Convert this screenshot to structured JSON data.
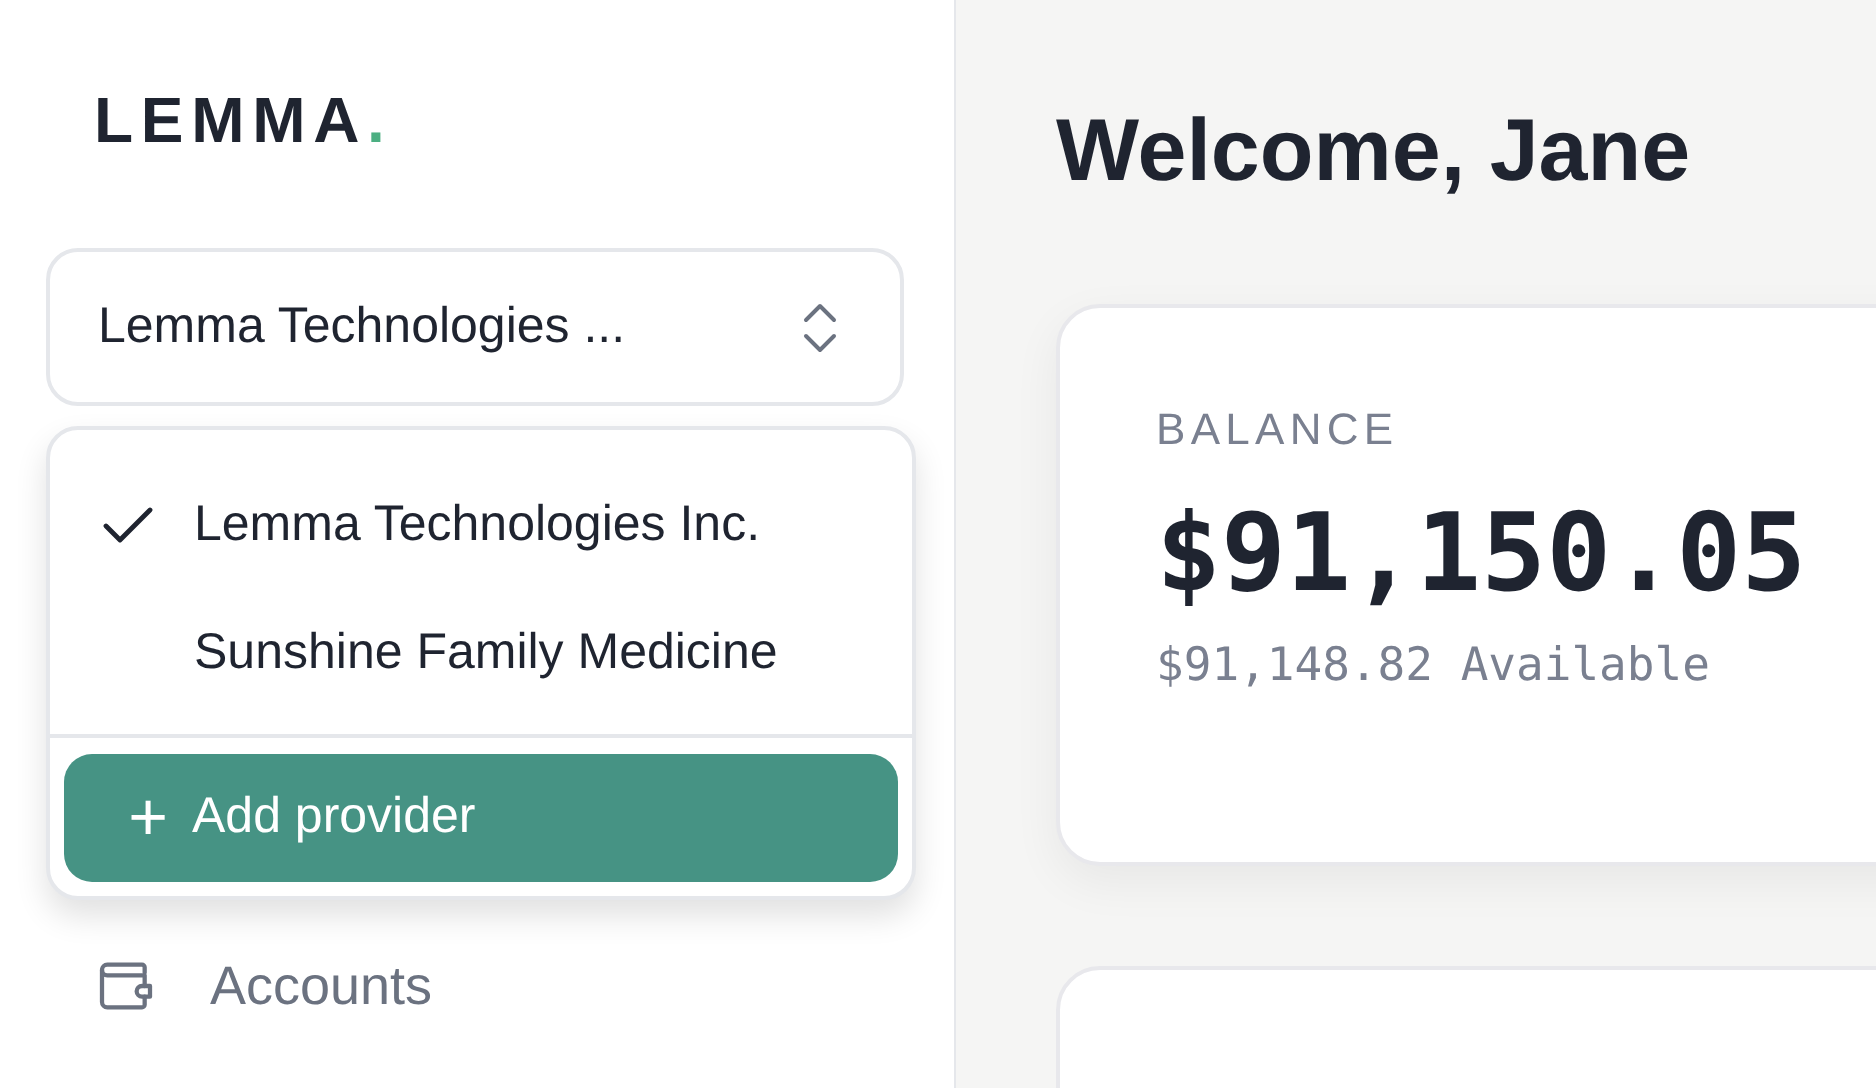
{
  "logo": {
    "text": "LEMMA",
    "mark": "."
  },
  "provider_select": {
    "value": "Lemma Technologies ...",
    "expanded": true
  },
  "provider_menu": {
    "items": [
      {
        "label": "Lemma Technologies Inc.",
        "selected": true
      },
      {
        "label": "Sunshine Family Medicine",
        "selected": false
      }
    ],
    "add_button": {
      "icon": "+",
      "label": "Add provider"
    }
  },
  "nav": {
    "items": [
      {
        "label": "Accounts",
        "kind": "wallet",
        "selected": false
      }
    ]
  },
  "main": {
    "greeting": "Welcome, Jane",
    "balance_card": {
      "label": "BALANCE",
      "amount": "$91,150.05",
      "available": "$91,148.82 Available"
    }
  }
}
